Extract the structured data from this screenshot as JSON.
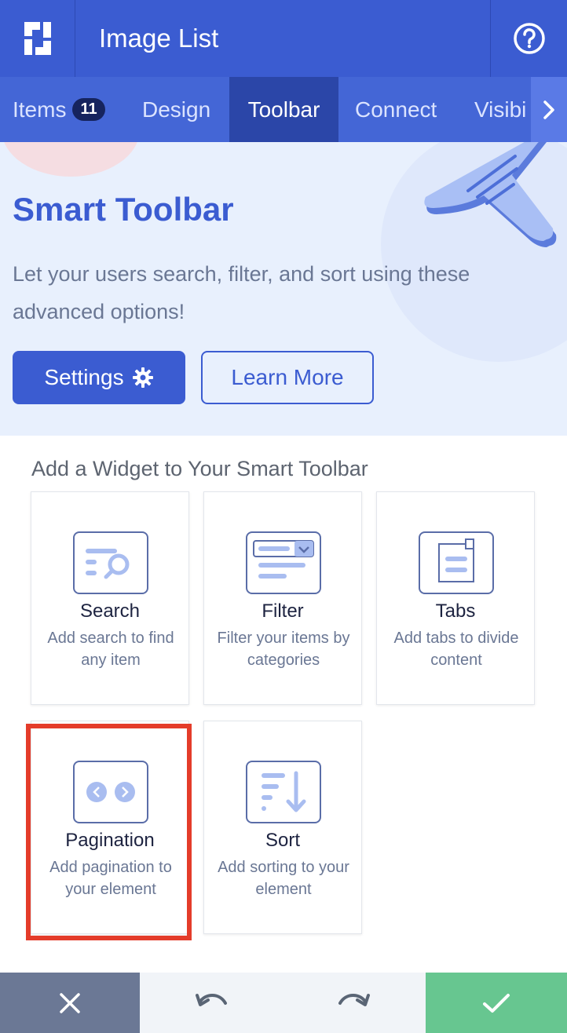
{
  "header": {
    "title": "Image List",
    "logo_icon": "logo-icon",
    "help_icon": "question-circle-icon"
  },
  "tabs": [
    {
      "label": "Items",
      "badge": "11"
    },
    {
      "label": "Design"
    },
    {
      "label": "Toolbar",
      "active": true
    },
    {
      "label": "Connect"
    },
    {
      "label": "Visibi"
    }
  ],
  "hero": {
    "title": "Smart Toolbar",
    "description": "Let your users search, filter, and sort using these advanced options!",
    "settings_label": "Settings",
    "learn_more_label": "Learn More"
  },
  "widgets": {
    "section_title": "Add a Widget to Your Smart Toolbar",
    "items": [
      {
        "name": "Search",
        "description": "Add search to find any item",
        "icon": "search-widget-icon"
      },
      {
        "name": "Filter",
        "description": "Filter your items by categories",
        "icon": "filter-widget-icon"
      },
      {
        "name": "Tabs",
        "description": "Add tabs to divide content",
        "icon": "tabs-widget-icon"
      },
      {
        "name": "Pagination",
        "description": "Add pagination to your element",
        "icon": "pagination-widget-icon",
        "highlighted": true
      },
      {
        "name": "Sort",
        "description": "Add sorting to your element",
        "icon": "sort-widget-icon"
      }
    ]
  },
  "footer": {
    "close_icon": "close-icon",
    "undo_icon": "undo-icon",
    "redo_icon": "redo-icon",
    "confirm_icon": "check-icon"
  },
  "colors": {
    "primary": "#3b5cd1",
    "tab_active": "#2b46a8",
    "hero_bg": "#e8f0fd",
    "highlight": "#e43c2a",
    "confirm": "#67c690",
    "close": "#6b7895"
  }
}
